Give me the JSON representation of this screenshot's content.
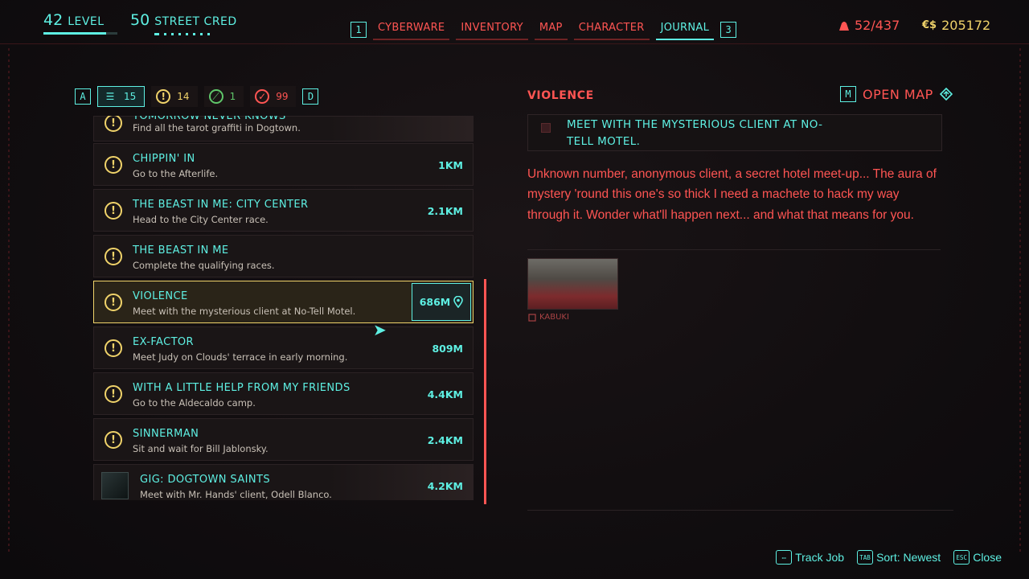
{
  "hud": {
    "level_value": "42",
    "level_label": "LEVEL",
    "level_progress": 0.85,
    "street_cred_value": "50",
    "street_cred_label": "STREET CRED",
    "weight": "52/437",
    "money_currency": "€$",
    "money": "205172"
  },
  "nav": {
    "left_key": "1",
    "right_key": "3",
    "tabs": [
      "CYBERWARE",
      "INVENTORY",
      "MAP",
      "CHARACTER",
      "JOURNAL"
    ],
    "active_tab": "JOURNAL"
  },
  "filters": {
    "left_key": "A",
    "right_key": "D",
    "all_count": "15",
    "main_count": "14",
    "side_count": "1",
    "done_count": "99"
  },
  "quests": [
    {
      "title": "TOMORROW NEVER KNOWS",
      "desc": "Find all the tarot graffiti in Dogtown.",
      "dist": ""
    },
    {
      "title": "CHIPPIN' IN",
      "desc": "Go to the Afterlife.",
      "dist": "1KM"
    },
    {
      "title": "THE BEAST IN ME: CITY CENTER",
      "desc": "Head to the City Center race.",
      "dist": "2.1KM"
    },
    {
      "title": "THE BEAST IN ME",
      "desc": "Complete the qualifying races.",
      "dist": ""
    },
    {
      "title": "VIOLENCE",
      "desc": "Meet with the mysterious client at No-Tell Motel.",
      "dist": "686M"
    },
    {
      "title": "EX-FACTOR",
      "desc": "Meet Judy on Clouds' terrace in early morning.",
      "dist": "809M"
    },
    {
      "title": "WITH A LITTLE HELP FROM MY FRIENDS",
      "desc": "Go to the Aldecaldo camp.",
      "dist": "4.4KM"
    },
    {
      "title": "SINNERMAN",
      "desc": "Sit and wait for Bill Jablonsky.",
      "dist": "2.4KM"
    },
    {
      "title": "GIG: DOGTOWN SAINTS",
      "desc": "Meet with Mr. Hands' client, Odell Blanco.",
      "dist": "4.2KM"
    }
  ],
  "detail": {
    "title": "VIOLENCE",
    "open_map_key": "M",
    "open_map_label": "OPEN MAP",
    "objective": "MEET WITH THE MYSTERIOUS CLIENT AT NO-TELL MOTEL.",
    "description": "Unknown number, anonymous client, a secret hotel meet-up... The aura of mystery 'round this one's so thick I need a machete to hack my way through it. Wonder what'll happen next... and what that means for you.",
    "location": "KABUKI"
  },
  "footer": {
    "track_label": "Track Job",
    "sort_key": "TAB",
    "sort_label": "Sort: Newest",
    "close_key": "ESC",
    "close_label": "Close"
  },
  "colors": {
    "cyan": "#5ef0e3",
    "red": "#ff5553",
    "yellow": "#f0d36a",
    "background": "#120e10"
  }
}
